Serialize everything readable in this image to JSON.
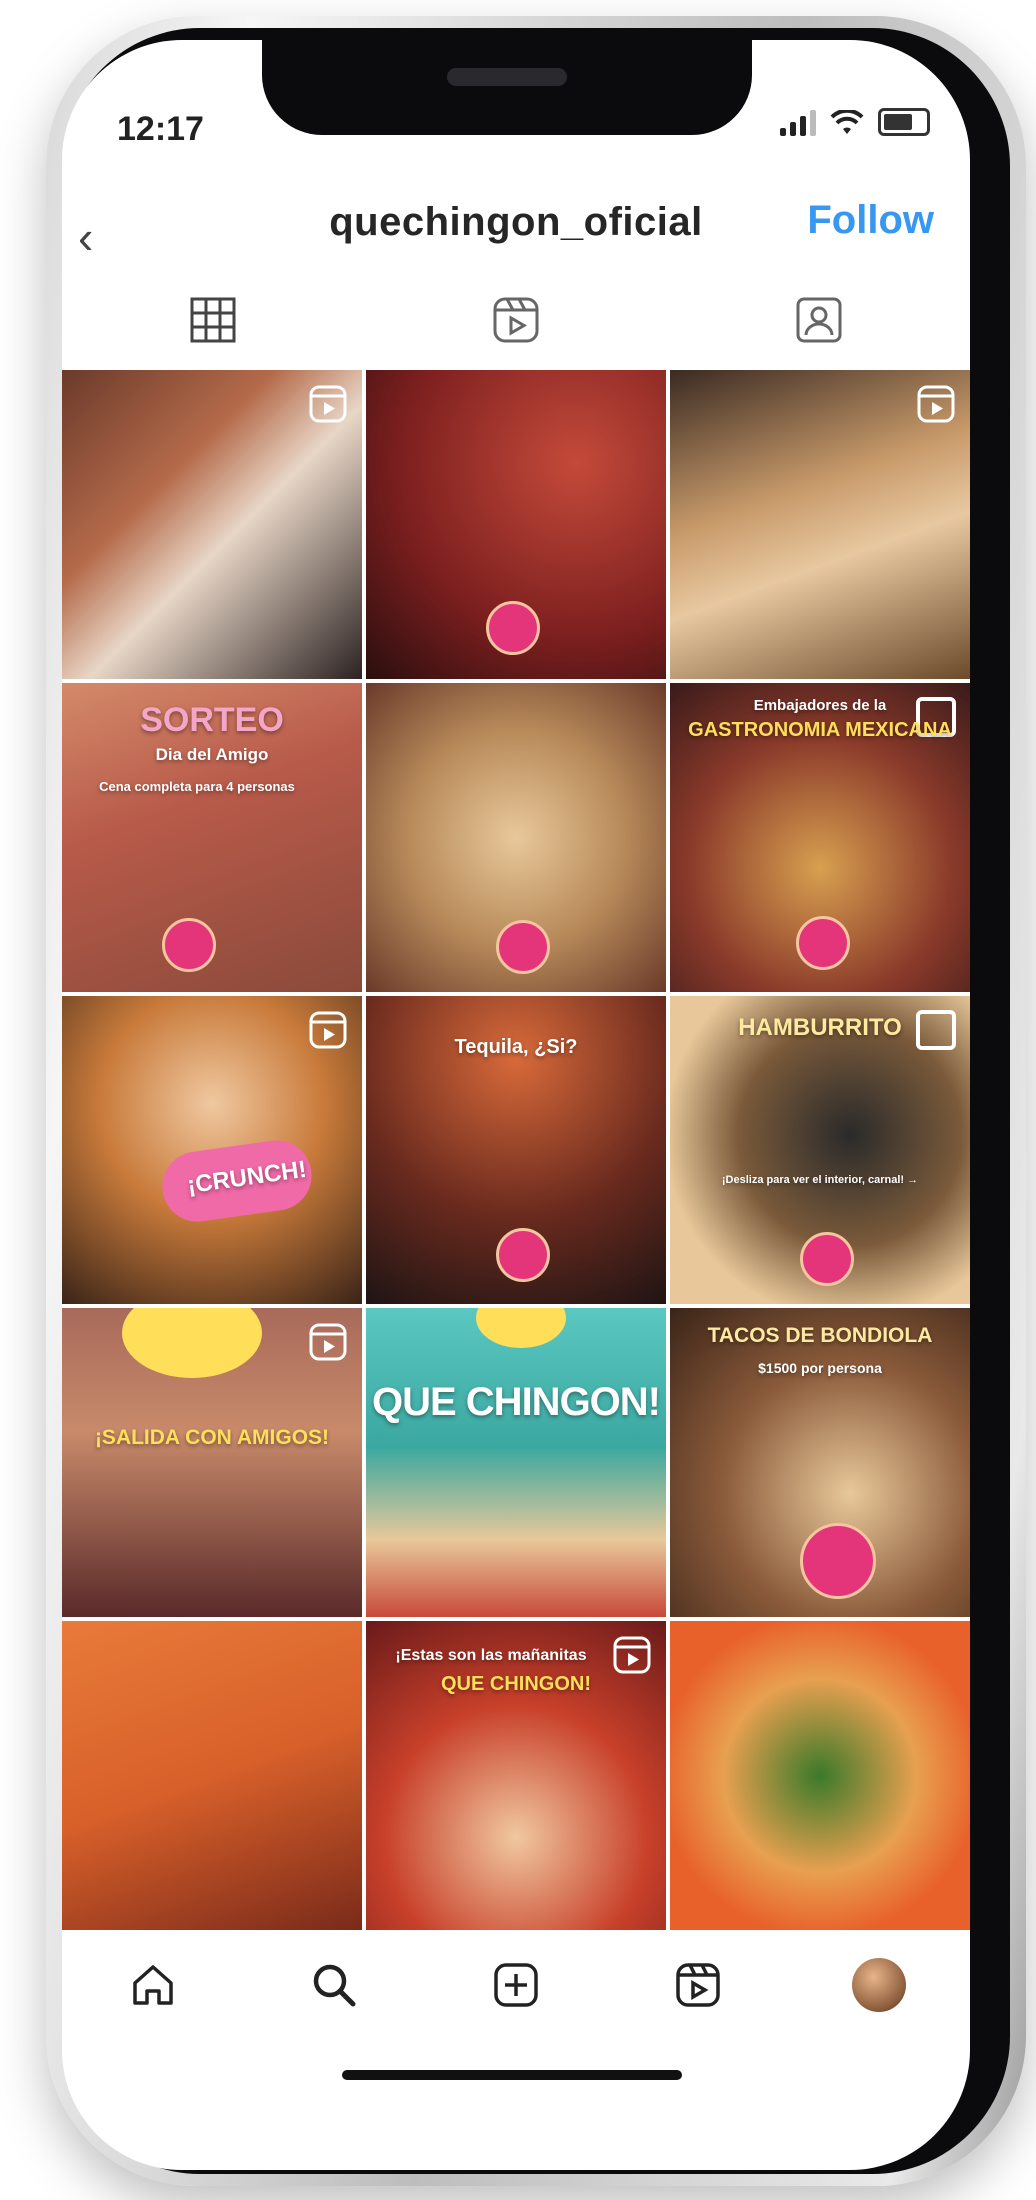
{
  "status_bar": {
    "time": "12:17"
  },
  "header": {
    "username": "quechingon_oficial",
    "follow_label": "Follow"
  },
  "tabs": [
    {
      "name": "grid-icon",
      "active": true
    },
    {
      "name": "reels-icon",
      "active": false
    },
    {
      "name": "tagged-icon",
      "active": false
    }
  ],
  "posts": [
    {
      "id": 1,
      "overlay": "",
      "type": "reel"
    },
    {
      "id": 2,
      "overlay": "",
      "type": "photo"
    },
    {
      "id": 3,
      "overlay": "",
      "type": "reel"
    },
    {
      "id": 4,
      "overlay_title": "SORTEO",
      "overlay_sub": "Dia del Amigo",
      "overlay_small": "Cena completa para 4 personas",
      "type": "photo"
    },
    {
      "id": 5,
      "overlay": "",
      "type": "photo"
    },
    {
      "id": 6,
      "overlay_small": "Embajadores de la",
      "overlay_title": "GASTRONOMIA MEXICANA",
      "type": "multi"
    },
    {
      "id": 7,
      "overlay_title": "¡CRUNCH!",
      "type": "reel"
    },
    {
      "id": 8,
      "overlay_title": "Tequila, ¿Si?",
      "type": "photo"
    },
    {
      "id": 9,
      "overlay_title": "HAMBURRITO",
      "overlay_small": "¡Desliza para ver el interior, carnal! →",
      "type": "multi"
    },
    {
      "id": 10,
      "overlay_title": "¡SALIDA CON AMIGOS!",
      "type": "reel"
    },
    {
      "id": 11,
      "overlay_title": "QUE CHINGON!",
      "type": "photo"
    },
    {
      "id": 12,
      "overlay_title": "TACOS DE BONDIOLA",
      "overlay_small": "$1500 por persona",
      "type": "photo"
    },
    {
      "id": 13,
      "overlay": "",
      "type": "photo"
    },
    {
      "id": 14,
      "overlay_small": "¡Estas son las mañanitas",
      "overlay_title": "QUE CHINGON!",
      "type": "reel"
    },
    {
      "id": 15,
      "overlay": "",
      "type": "photo"
    }
  ],
  "bottom_nav": [
    {
      "name": "home-icon"
    },
    {
      "name": "search-icon"
    },
    {
      "name": "new-post-icon"
    },
    {
      "name": "reels-icon"
    },
    {
      "name": "profile-avatar"
    }
  ],
  "colors": {
    "follow": "#3897f0",
    "accent_pink": "#e4347a",
    "yellow": "#ffde59"
  }
}
